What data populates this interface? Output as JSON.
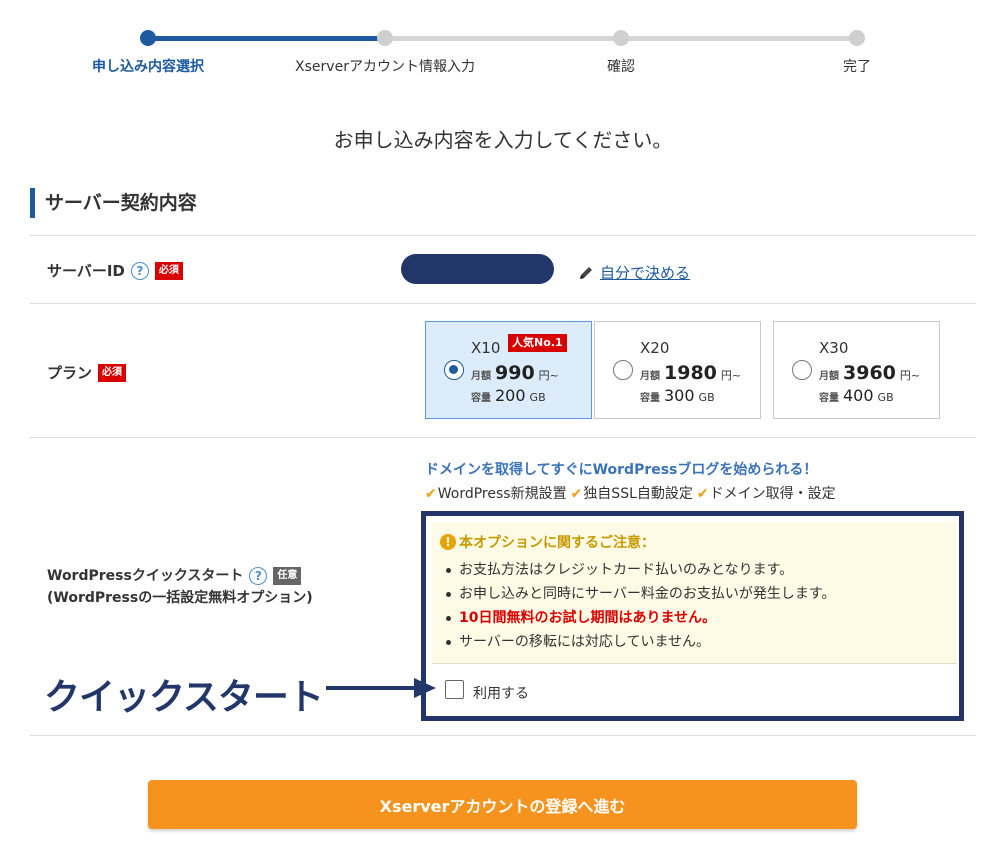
{
  "stepper": {
    "steps": [
      {
        "label": "申し込み内容選択",
        "active": true
      },
      {
        "label": "Xserverアカウント情報入力",
        "active": false
      },
      {
        "label": "確認",
        "active": false
      },
      {
        "label": "完了",
        "active": false
      }
    ]
  },
  "intro": "お申し込み内容を入力してください。",
  "section_title": "サーバー契約内容",
  "server_id": {
    "label": "サーバーID",
    "required_badge": "必須",
    "self_link": "自分で決める"
  },
  "plan": {
    "label": "プラン",
    "required_badge": "必須",
    "options": [
      {
        "name": "X10",
        "badge": "人気No.1",
        "price_prefix": "月額",
        "price": "990",
        "price_unit": "円~",
        "cap_prefix": "容量",
        "capacity": "200",
        "cap_unit": "GB",
        "selected": true
      },
      {
        "name": "X20",
        "badge": "",
        "price_prefix": "月額",
        "price": "1980",
        "price_unit": "円~",
        "cap_prefix": "容量",
        "capacity": "300",
        "cap_unit": "GB",
        "selected": false
      },
      {
        "name": "X30",
        "badge": "",
        "price_prefix": "月額",
        "price": "3960",
        "price_unit": "円~",
        "cap_prefix": "容量",
        "capacity": "400",
        "cap_unit": "GB",
        "selected": false
      }
    ]
  },
  "wordpress": {
    "label_line1": "WordPressクイックスタート",
    "optional_badge": "任意",
    "label_line2": "(WordPressの一括設定無料オプション)",
    "headline": "ドメインを取得してすぐにWordPressブログを始められる！",
    "features": [
      "WordPress新規設置",
      "独自SSL自動設定",
      "ドメイン取得・設定"
    ],
    "notice_title": "本オプションに関するご注意：",
    "notices": [
      {
        "text": "お支払方法はクレジットカード払いのみとなります。",
        "red": false
      },
      {
        "text": "お申し込みと同時にサーバー料金のお支払いが発生します。",
        "red": false
      },
      {
        "text": "10日間無料のお試し期間はありません。",
        "red": true
      },
      {
        "text": "サーバーの移転には対応していません。",
        "red": false
      }
    ],
    "checkbox_label": "利用する"
  },
  "annotation": "クイックスタート",
  "cta_label": "Xserverアカウントの登録へ進む",
  "colors": {
    "accent": "#1e5aa0",
    "navy": "#22366a",
    "required": "#d90000",
    "cta": "#f5931e",
    "check": "#f39c12"
  }
}
